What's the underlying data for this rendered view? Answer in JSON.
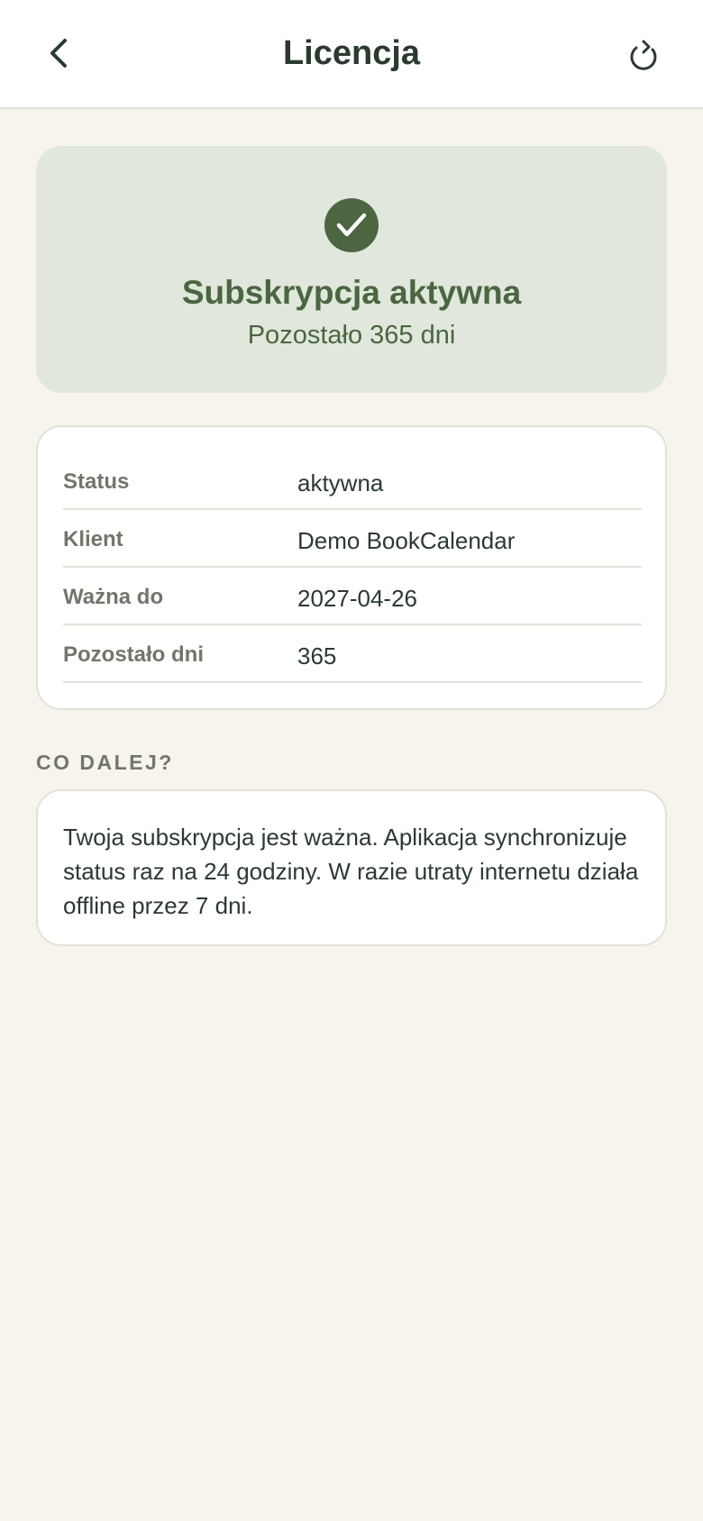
{
  "header": {
    "title": "Licencja",
    "back_icon": "chevron-left-icon",
    "refresh_icon": "refresh-icon"
  },
  "status": {
    "icon": "check-circle-icon",
    "headline": "Subskrypcja aktywna",
    "subtitle": "Pozostało 365 dni"
  },
  "details": [
    {
      "label": "Status",
      "value": "aktywna"
    },
    {
      "label": "Klient",
      "value": "Demo BookCalendar"
    },
    {
      "label": "Ważna do",
      "value": "2027-04-26"
    },
    {
      "label": "Pozostało dni",
      "value": "365"
    }
  ],
  "next": {
    "section_title": "CO DALEJ?",
    "text": "Twoja subskrypcja jest ważna. Aplikacja synchronizuje status raz na 24 godziny. W razie utraty internetu działa offline przez 7 dni."
  },
  "colors": {
    "accent": "#4b6640",
    "status_card_bg": "#e1e7dd",
    "page_bg": "#f7f4ee",
    "text": "#2b3a2f",
    "muted": "#74756a"
  }
}
